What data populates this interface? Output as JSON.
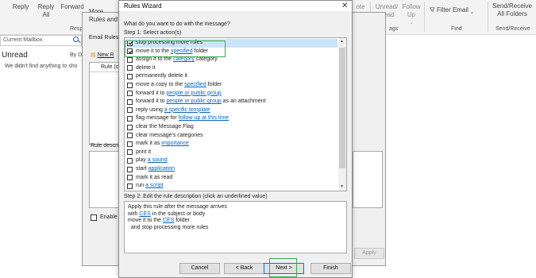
{
  "ribbon": {
    "reply_label": "Reply",
    "reply_all_label": "Reply All",
    "forward_label": "Forward",
    "more_label": "More",
    "respond_group": "Respond",
    "note_label": "ote",
    "unread_label": "Unread/",
    "read_label": "Read",
    "follow_up_label": "Follow Up",
    "tags_group": "ags",
    "filter_email_label": "Filter Email",
    "find_group": "Find",
    "send_receive_label": "Send/Receive All Folders",
    "send_receive_group": "Send/Receive"
  },
  "mail": {
    "search_placeholder": "Current Mailbox",
    "unread_tab": "Unread",
    "by_date": "By Da",
    "empty_text": "We didn't find anything to sho"
  },
  "rules_alerts": {
    "title": "Rules and A",
    "email_rules_tab": "Email Rules",
    "new_rule_button": "New R",
    "rule_column": "Rule (c",
    "rule_description_label": "Rule descrip",
    "enable_label": "Enable r",
    "apply_button": "Apply"
  },
  "wizard": {
    "title": "Rules Wizard",
    "question": "What do you want to do with the message?",
    "step1_label": "Step 1: Select action(s)",
    "actions": [
      {
        "pre": "stop processing more rules",
        "link": "",
        "post": "",
        "checked": true,
        "selected": true
      },
      {
        "pre": "move it to the ",
        "link": "specified",
        "post": " folder",
        "checked": true,
        "selected": false
      },
      {
        "pre": "assign it to the ",
        "link": "category",
        "post": " category",
        "checked": false,
        "selected": false
      },
      {
        "pre": "delete it",
        "link": "",
        "post": "",
        "checked": false,
        "selected": false
      },
      {
        "pre": "permanently delete it",
        "link": "",
        "post": "",
        "checked": false,
        "selected": false
      },
      {
        "pre": "move a copy to the ",
        "link": "specified",
        "post": " folder",
        "checked": false,
        "selected": false
      },
      {
        "pre": "forward it to ",
        "link": "people or public group",
        "post": "",
        "checked": false,
        "selected": false
      },
      {
        "pre": "forward it to ",
        "link": "people or public group",
        "post": " as an attachment",
        "checked": false,
        "selected": false
      },
      {
        "pre": "reply using ",
        "link": "a specific template",
        "post": "",
        "checked": false,
        "selected": false
      },
      {
        "pre": "flag message for ",
        "link": "follow up at this time",
        "post": "",
        "checked": false,
        "selected": false
      },
      {
        "pre": "clear the Message Flag",
        "link": "",
        "post": "",
        "checked": false,
        "selected": false
      },
      {
        "pre": "clear message's categories",
        "link": "",
        "post": "",
        "checked": false,
        "selected": false
      },
      {
        "pre": "mark it as ",
        "link": "importance",
        "post": "",
        "checked": false,
        "selected": false
      },
      {
        "pre": "print it",
        "link": "",
        "post": "",
        "checked": false,
        "selected": false
      },
      {
        "pre": "play ",
        "link": "a sound",
        "post": "",
        "checked": false,
        "selected": false
      },
      {
        "pre": "start ",
        "link": "application",
        "post": "",
        "checked": false,
        "selected": false
      },
      {
        "pre": "mark it as read",
        "link": "",
        "post": "",
        "checked": false,
        "selected": false
      },
      {
        "pre": "run ",
        "link": "a script",
        "post": "",
        "checked": false,
        "selected": false
      }
    ],
    "step2_label": "Step 2: Edit the rule description (click an underlined value)",
    "description": [
      {
        "pre": "Apply this rule after the message arrives",
        "link": "",
        "post": ""
      },
      {
        "pre": "with ",
        "link": "CES",
        "post": " in the subject or body"
      },
      {
        "pre": "move it to the ",
        "link": "CES",
        "post": " folder"
      },
      {
        "pre": "  and stop processing more rules",
        "link": "",
        "post": ""
      }
    ],
    "buttons": {
      "cancel": "Cancel",
      "back": "< Back",
      "next": "Next >",
      "finish": "Finish"
    },
    "close_glyph": "✕"
  },
  "colors": {
    "highlight_green": "#3daa4c",
    "selection_blue": "#cce4f7",
    "link_blue": "#0563c1"
  }
}
